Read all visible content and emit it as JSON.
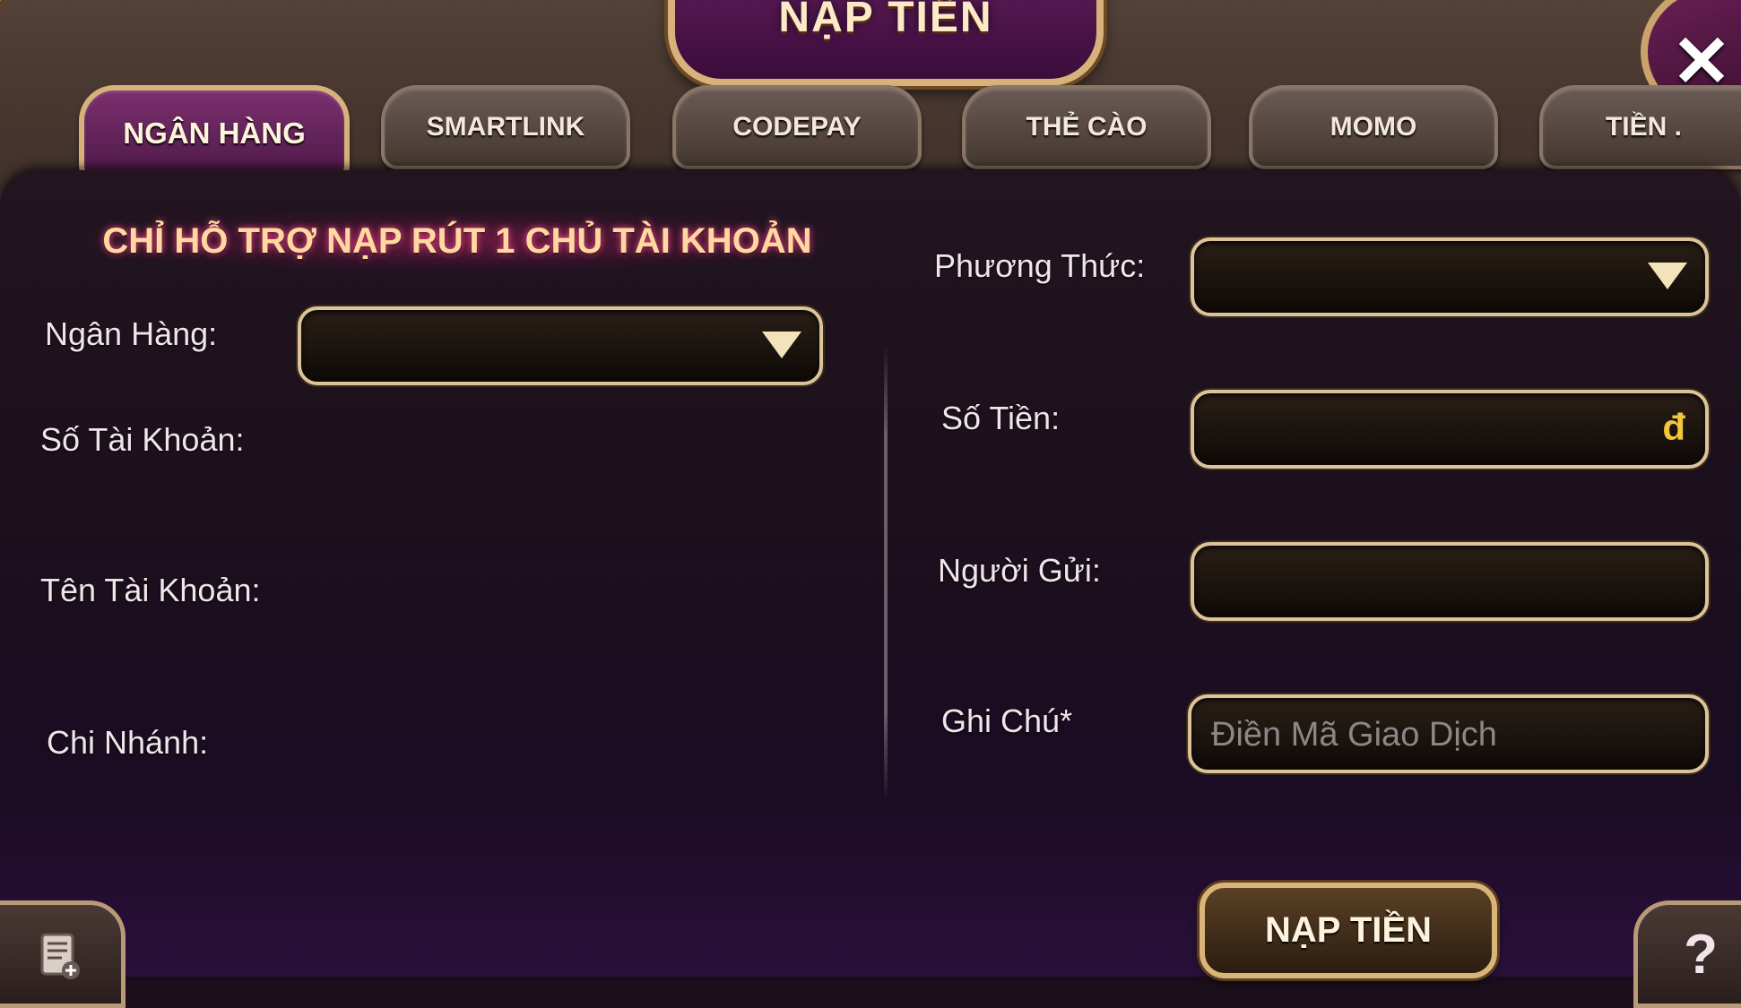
{
  "header": {
    "title": "NẠP TIỀN"
  },
  "tabs": [
    {
      "label": "NGÂN HÀNG",
      "active": true
    },
    {
      "label": "SMARTLINK",
      "active": false
    },
    {
      "label": "CODEPAY",
      "active": false
    },
    {
      "label": "THẺ CÀO",
      "active": false
    },
    {
      "label": "MOMO",
      "active": false
    },
    {
      "label": "TIỀN .",
      "active": false
    }
  ],
  "notice": "CHỈ HỖ TRỢ NẠP RÚT 1 CHỦ TÀI KHOẢN",
  "left": {
    "bank_label": "Ngân Hàng:",
    "account_number_label": "Số Tài Khoản:",
    "account_name_label": "Tên Tài Khoản:",
    "branch_label": "Chi Nhánh:"
  },
  "right": {
    "method_label": "Phương Thức:",
    "amount_label": "Số Tiền:",
    "currency_symbol": "đ",
    "sender_label": "Người Gửi:",
    "note_label": "Ghi Chú*",
    "note_placeholder": "Điền Mã Giao Dịch"
  },
  "submit_label": "NẠP TIỀN",
  "icons": {
    "close": "close-icon",
    "history": "history-icon",
    "help": "help-icon"
  }
}
